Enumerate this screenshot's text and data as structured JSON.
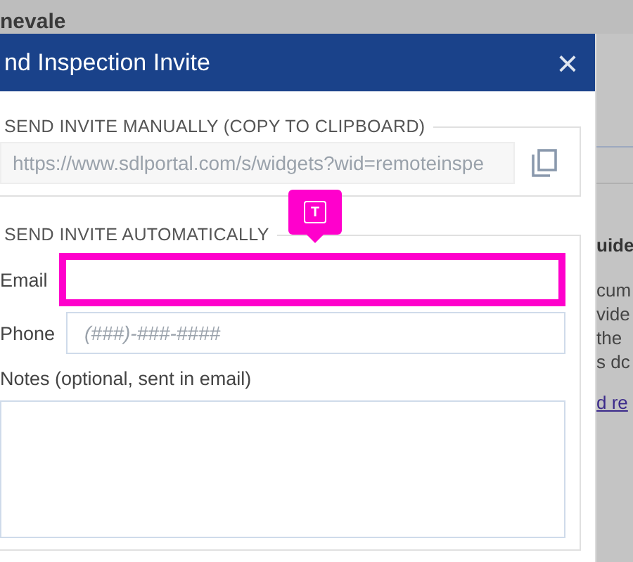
{
  "background_page": {
    "title": "nevale",
    "heading": "uide",
    "text_lines": [
      "cum",
      "vide",
      "the",
      "s dc"
    ],
    "link": "d re"
  },
  "dialog": {
    "title": "nd Inspection Invite",
    "close": "×",
    "manual": {
      "legend": "SEND INVITE MANUALLY (COPY TO CLIPBOARD)",
      "url": "https://www.sdlportal.com/s/widgets?wid=remoteinspe"
    },
    "automatic": {
      "legend": "SEND INVITE AUTOMATICALLY",
      "fields": [
        {
          "kind": "input",
          "label": "Email",
          "highlighted": true,
          "badge": "T"
        },
        {
          "kind": "input",
          "label": "Phone",
          "placeholder": "(###)-###-####",
          "highlighted": false
        },
        {
          "kind": "textarea",
          "label": "Notes (optional, sent in email)",
          "highlighted": false
        }
      ]
    }
  }
}
